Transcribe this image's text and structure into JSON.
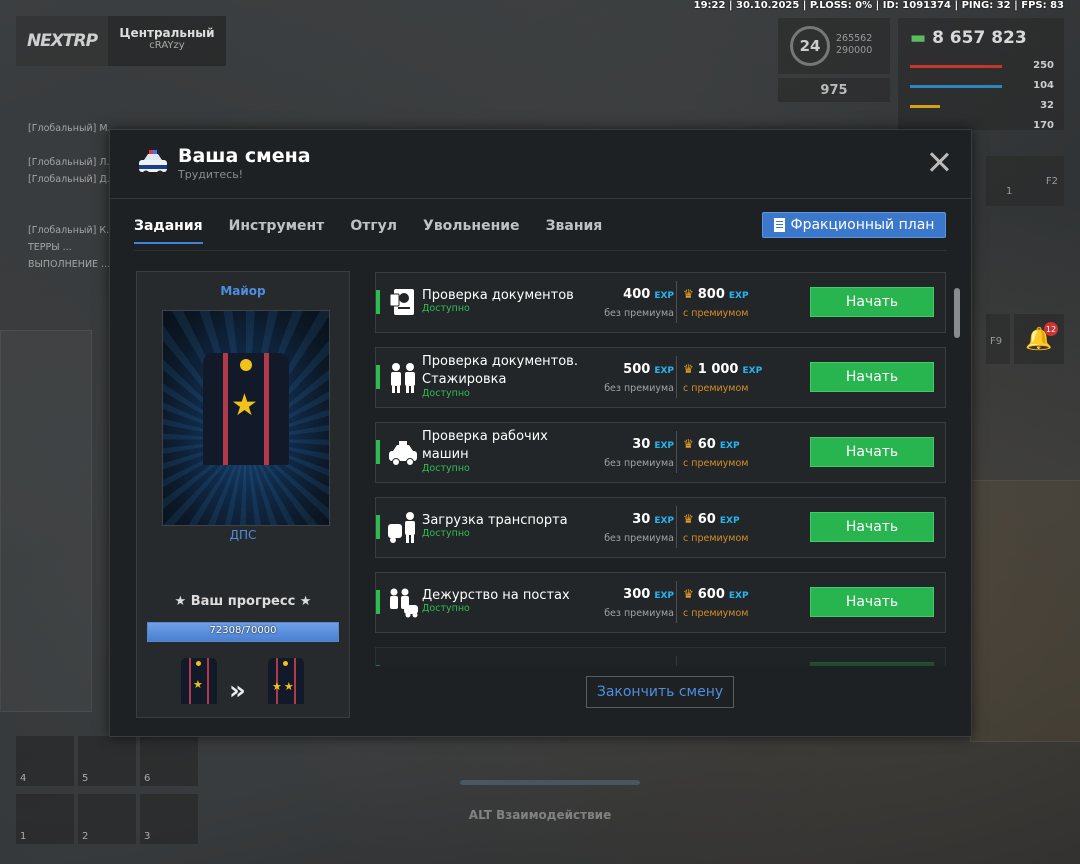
{
  "topbar": {
    "text": "19:22 | 30.10.2025 | P.LOSS: 0% | ID: 1091374 | PING: 32 | FPS: 83"
  },
  "server": {
    "logo": "NEXTRP",
    "name": "Центральный",
    "user": "cRAYzy"
  },
  "chat": {
    "lines": [
      "[Глобальный] М... ",
      "[Глобальный] Л...",
      "[Глобальный] Д...",
      "[Глобальный] К...",
      "ТЕРРЫ ...",
      "ВЫПОЛНЕНИЕ ..."
    ]
  },
  "hud": {
    "level": "24",
    "xp": "265562",
    "xp_max": "290000",
    "reputation": "975",
    "money": "8 657 823",
    "stats": [
      "250",
      "104",
      "32",
      "170"
    ],
    "stat_colors": [
      "#c0392b",
      "#2e86c1",
      "#d4a017",
      "#7f8c8d"
    ],
    "hotkey_f2": "F2",
    "hotkey_f9": "F9",
    "slot_f2_count": "1",
    "notif_count": "12"
  },
  "inventory": {
    "slots": [
      "4",
      "5",
      "6",
      "1",
      "2",
      "3"
    ]
  },
  "alt_hint": "ALT Взаимодействие",
  "modal": {
    "title": "Ваша смена",
    "subtitle": "Трудитесь!",
    "tabs": [
      "Задания",
      "Инструмент",
      "Отгул",
      "Увольнение",
      "Звания"
    ],
    "active_tab": 0,
    "plan_button": "Фракционный план",
    "end_button": "Закончить смену"
  },
  "rank": {
    "title": "Майор",
    "division": "ДПС",
    "progress_label": "★ Ваш прогресс ★",
    "progress_text": "72308/70000",
    "progress_fraction": 1.0
  },
  "tasks": [
    {
      "name": "Проверка документов",
      "status": "Доступно",
      "base": "400",
      "prem": "800",
      "exp": "EXP",
      "base_label": "без премиума",
      "prem_label": "с премиумом",
      "button": "Начать",
      "icon": "passport-icon"
    },
    {
      "name": "Проверка документов. Стажировка",
      "status": "Доступно",
      "base": "500",
      "prem": "1 000",
      "exp": "EXP",
      "base_label": "без премиума",
      "prem_label": "с премиумом",
      "button": "Начать",
      "icon": "officers-icon"
    },
    {
      "name": "Проверка рабочих машин",
      "status": "Доступно",
      "base": "30",
      "prem": "60",
      "exp": "EXP",
      "base_label": "без премиума",
      "prem_label": "с премиумом",
      "button": "Начать",
      "icon": "police-car-icon"
    },
    {
      "name": "Загрузка транспорта",
      "status": "Доступно",
      "base": "30",
      "prem": "60",
      "exp": "EXP",
      "base_label": "без премиума",
      "prem_label": "с премиумом",
      "button": "Начать",
      "icon": "tow-officer-icon"
    },
    {
      "name": "Дежурство на постах",
      "status": "Доступно",
      "base": "300",
      "prem": "600",
      "exp": "EXP",
      "base_label": "без премиума",
      "prem_label": "с премиумом",
      "button": "Начать",
      "icon": "post-duty-icon"
    }
  ],
  "colors": {
    "accent": "#3b78cc",
    "start": "#28b44e",
    "exp": "#26b5f0",
    "premium": "#d68d28"
  }
}
